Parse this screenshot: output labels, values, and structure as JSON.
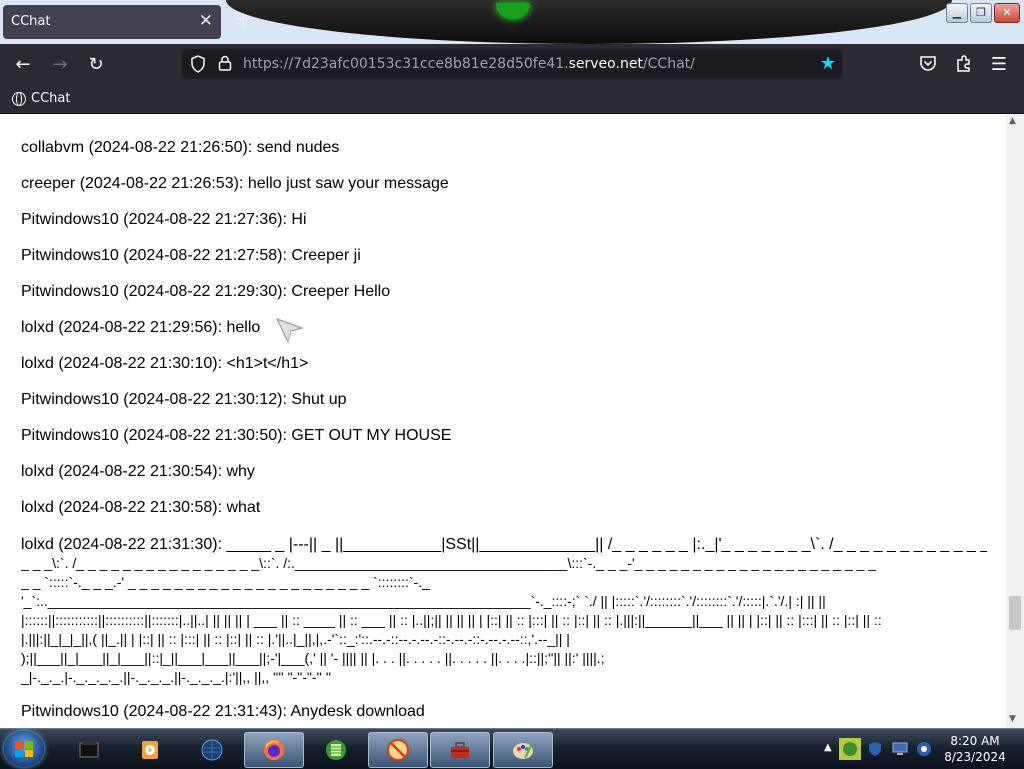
{
  "browser": {
    "tab": {
      "title": "CChat"
    },
    "url": {
      "prefix": "https://7d23afc00153c31cce8b81e28d50fe41.",
      "domain": "serveo.net",
      "path": "/CChat/"
    },
    "bookmarks": [
      {
        "label": "CChat",
        "icon": "globe-icon"
      }
    ]
  },
  "chat": {
    "messages": [
      {
        "text": "collabvm (2024-08-22 21:26:50): send nudes"
      },
      {
        "text": "creeper (2024-08-22 21:26:53): hello just saw your message"
      },
      {
        "text": "Pitwindows10 (2024-08-22 21:27:36): Hi"
      },
      {
        "text": "Pitwindows10 (2024-08-22 21:27:58): Creeper ji"
      },
      {
        "text": "Pitwindows10 (2024-08-22 21:29:30): Creeper Hello"
      },
      {
        "text": "lolxd (2024-08-22 21:29:56): hello"
      },
      {
        "text": "lolxd (2024-08-22 21:30:10): <h1>t</h1>"
      },
      {
        "text": "Pitwindows10 (2024-08-22 21:30:12): Shut up"
      },
      {
        "text": "Pitwindows10 (2024-08-22 21:30:50): GET OUT MY HOUSE"
      },
      {
        "text": "lolxd (2024-08-22 21:30:54): why"
      },
      {
        "text": "lolxd (2024-08-22 21:30:58): what"
      }
    ],
    "ascii_message": {
      "lines": [
        "lolxd (2024-08-22 21:31:30): _____ _ |---|| _ ||___________|SSt||_____________|| /_ _ _ _ _ _ |:._|'_ _ _ _ _ _ _\\`. /_ _ _ _ _ _ _ _ _ _ _ _ _ _ _",
        "_ _ _\\:`. /_ _ _ _ _ _ _ _ _ _ _ _ _ _ _ _\\::`. /:.___________________________________\\:::`-._ _ _-'_ _ _ _ _ _ _ _ _ _ _ _ _ _ _ _ _ _ _ _ _",
        "_ _ `:::::`-._ _ _.-' _ _ _ _ _ _ _ _ _ _ _ _ _ _ _ _ _ _ _ _ _ `::::::::`-._",
        "'_`:..______________________________________________________________`-._::::-;` `./ || |:::::`.'/::::::::`.'/::::::::`.'/:::::|.`.'/.| :| || ||",
        "|::::::||:::::::::::||::::::::::||:::::::|..||..| || || || | ___ || :: ____ || :: ___ || :: |..||;|| || || || | |::| || :: |:::| || :: |::| || :: |.|||:||______||___ || || | |::| || :: |:::| || :: |::| || ::",
        "|.|||:||_|_|_||,( ||_.|| | |::| || :: |:::| || :: |::| || :: |.'||..|_||,|,.-'`::_:'::.--.-::--.-.--.-::-.--.-::-.--.-.--::,'.--_|| |",
        ");||___||_|___||_|___||::|_||___|___||___||;-'|___(,' || '- |||| || |. . . ||. . . . . ||. . . . . ||. . . .|::||;''|| ||:' ||||.;",
        "_|-._._.|-._._._._.||-._._._.||-._._._.|:'||,, ||,, '''' \"-\"-\"-'' ''"
      ]
    },
    "after_messages": [
      {
        "text": "Pitwindows10 (2024-08-22 21:31:43): Anydesk download"
      }
    ]
  },
  "taskbar": {
    "clock_time": "8:20 AM",
    "clock_date": "8/23/2024",
    "apps": [
      "terminal-icon",
      "media-player-icon",
      "network-globe-icon",
      "firefox-icon",
      "film-icon",
      "no-virus-icon",
      "toolbox-icon",
      "paint-icon"
    ]
  }
}
